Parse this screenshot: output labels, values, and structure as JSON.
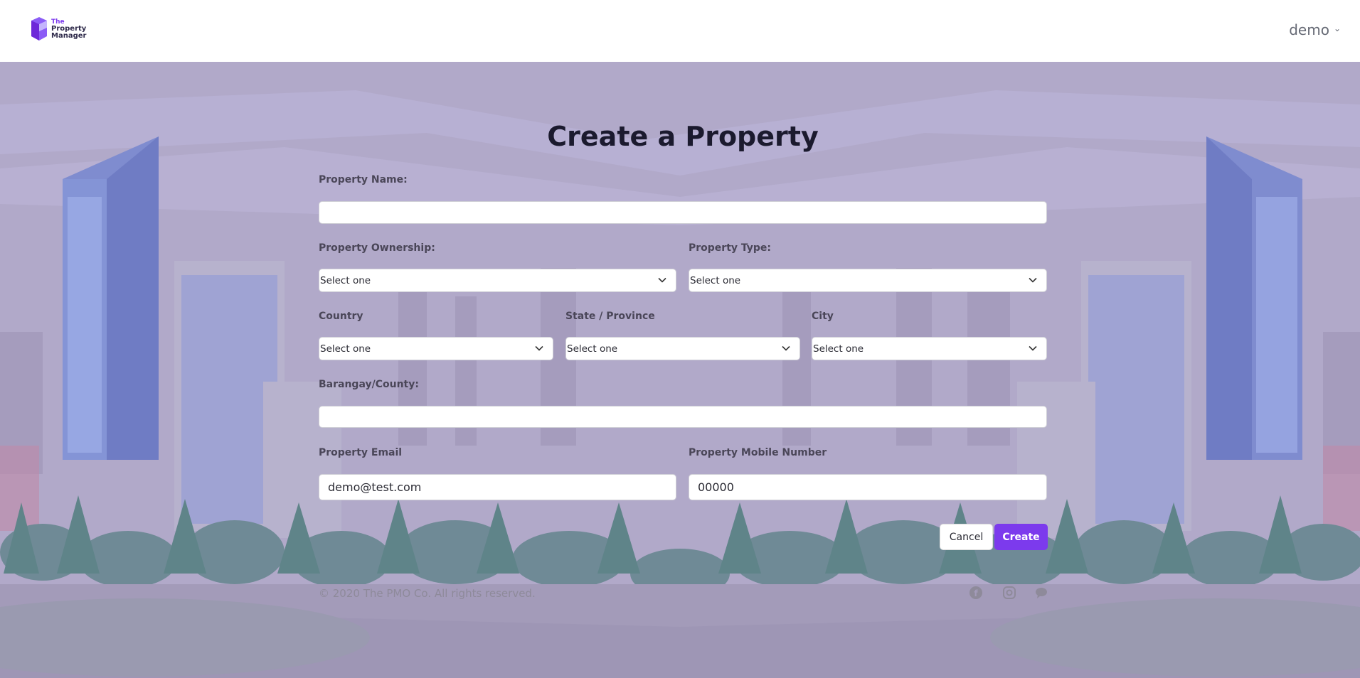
{
  "header": {
    "logo_line1": "The",
    "logo_line2": "Property",
    "logo_line3": "Manager",
    "user_name": "demo"
  },
  "form": {
    "title": "Create a Property",
    "property_name": {
      "label": "Property Name:",
      "value": ""
    },
    "ownership": {
      "label": "Property Ownership:",
      "value": "Select one"
    },
    "type": {
      "label": "Property Type:",
      "value": "Select one"
    },
    "country": {
      "label": "Country",
      "value": "Select one"
    },
    "state": {
      "label": "State / Province",
      "value": "Select one"
    },
    "city": {
      "label": "City",
      "value": "Select one"
    },
    "barangay": {
      "label": "Barangay/County:",
      "value": ""
    },
    "email": {
      "label": "Property Email",
      "value": "demo@test.com"
    },
    "mobile": {
      "label": "Property Mobile Number",
      "value": "00000"
    },
    "cancel_label": "Cancel",
    "create_label": "Create"
  },
  "footer": {
    "copyright": "© 2020 The PMO Co. All rights reserved."
  },
  "colors": {
    "accent": "#7c3aed",
    "background": "#b1a9c9"
  }
}
